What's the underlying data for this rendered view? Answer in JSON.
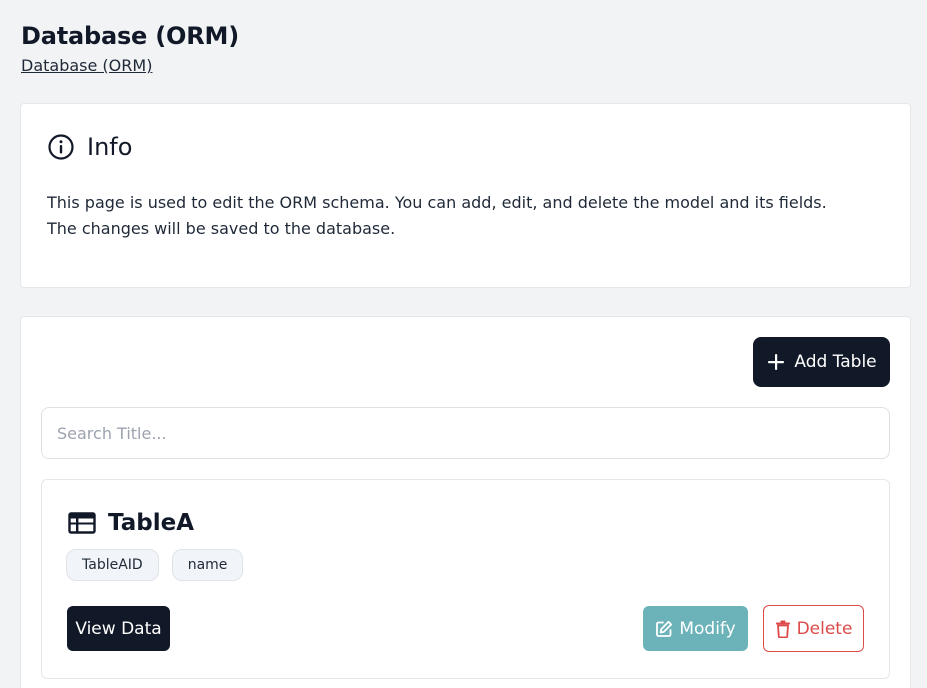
{
  "page": {
    "title": "Database (ORM)",
    "breadcrumb": "Database (ORM)"
  },
  "info": {
    "icon": "info-circle-icon",
    "title": "Info",
    "line1": "This page is used to edit the ORM schema. You can add, edit, and delete the model and its fields.",
    "line2": "The changes will be saved to the database."
  },
  "toolbar": {
    "add_table_label": "Add Table",
    "add_table_icon": "plus-icon"
  },
  "search": {
    "placeholder": "Search Title...",
    "value": ""
  },
  "tables": [
    {
      "name": "TableA",
      "icon": "table-icon",
      "fields": [
        "TableAID",
        "name"
      ],
      "view_label": "View Data",
      "modify_label": "Modify",
      "delete_label": "Delete"
    }
  ],
  "colors": {
    "primary": "#111827",
    "modify": "#6bb3b9",
    "danger": "#dc4a4a",
    "background": "#f2f3f5"
  }
}
